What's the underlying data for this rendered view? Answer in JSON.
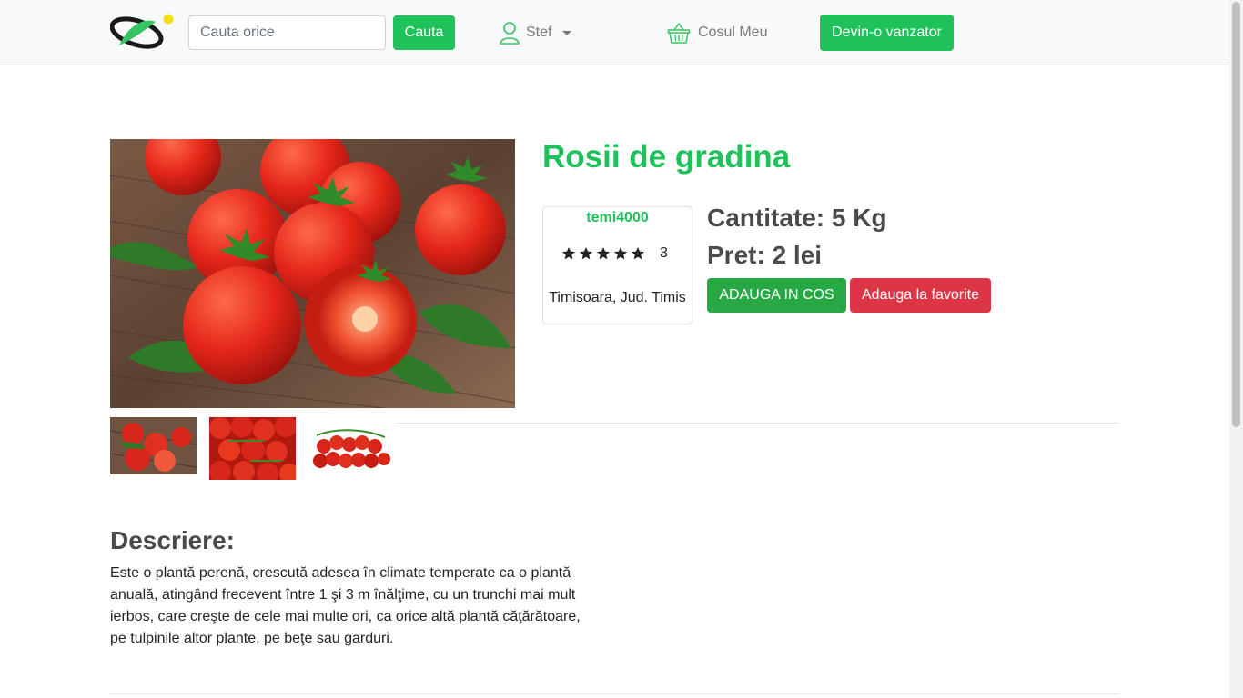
{
  "navbar": {
    "search_placeholder": "Cauta orice",
    "search_button": "Cauta",
    "user_name": "Stef",
    "cart_label": "Cosul Meu",
    "vendor_button": "Devin-o vanzator"
  },
  "product": {
    "title": "Rosii de gradina",
    "quantity": "Cantitate: 5 Kg",
    "price": "Pret: 2 lei",
    "add_to_cart": "ADAUGA IN COS",
    "add_to_favorites": "Adauga la favorite",
    "images": {
      "main": "tomatoes on wooden table",
      "thumbnails": [
        "tomatoes on wooden table",
        "tomato cluster",
        "cherry tomatoes on vine"
      ]
    }
  },
  "seller": {
    "name": "temi4000",
    "stars": 5,
    "rating_count": "3",
    "location": "Timisoara, Jud. Timis"
  },
  "description": {
    "heading": "Descriere:",
    "text": "Este o plantă perenă, crescută adesea în climate temperate ca o plantă anuală, atingând frecevent între 1 şi 3 m înălţime, cu un trunchi mai mult ierbos, care creşte de cele mai multe ori, ca orice altă plantă căţărătoare, pe tulpinile altor plante, pe beţe sau garduri."
  },
  "colors": {
    "brand_green": "#1fc15b",
    "success_green": "#28a745",
    "danger_red": "#dc3545",
    "navbar_bg": "#f8f9fa"
  }
}
